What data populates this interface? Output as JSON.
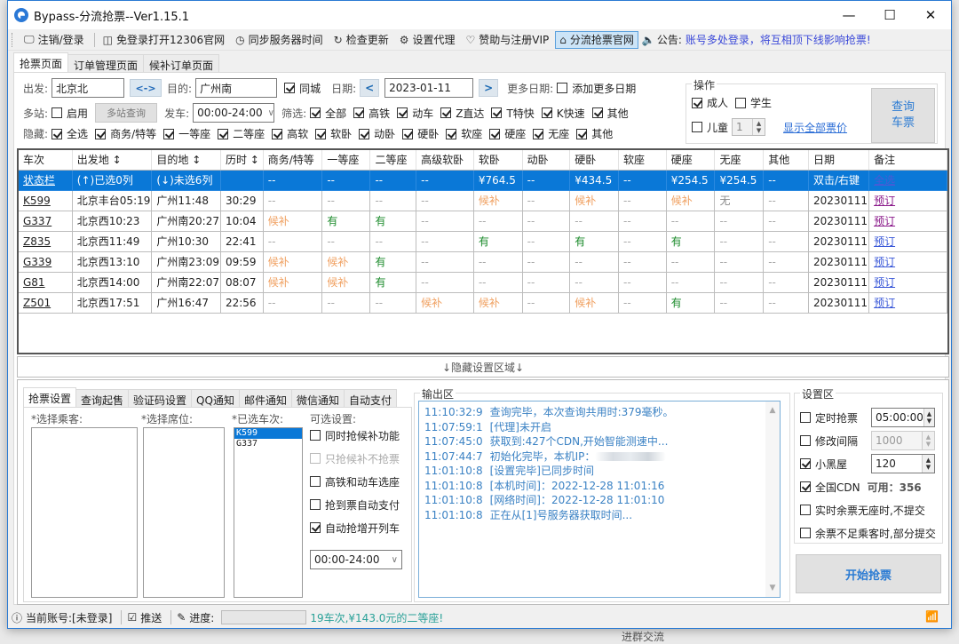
{
  "window": {
    "title": "Bypass-分流抢票--Ver1.15.1",
    "controls": {
      "minimize": "—",
      "maximize": "☐",
      "close": "✕"
    }
  },
  "menubar": {
    "items": [
      {
        "icon": "monitor-icon",
        "glyph": "🖵",
        "label": "注销/登录"
      },
      {
        "icon": "window-icon",
        "glyph": "◫",
        "label": "免登录打开12306官网"
      },
      {
        "icon": "clock-icon",
        "glyph": "◷",
        "label": "同步服务器时间"
      },
      {
        "icon": "refresh-icon",
        "glyph": "↻",
        "label": "检查更新"
      },
      {
        "icon": "gear-icon",
        "glyph": "⚙",
        "label": "设置代理"
      },
      {
        "icon": "heart-icon",
        "glyph": "♡",
        "label": "赞助与注册VIP"
      },
      {
        "icon": "home-icon",
        "glyph": "⌂",
        "label": "分流抢票官网"
      }
    ],
    "notice_label": "公告:",
    "notice_text": "账号多处登录，将互相顶下线影响抢票!"
  },
  "page_tabs": [
    "抢票页面",
    "订单管理页面",
    "候补订单页面"
  ],
  "search": {
    "from_label": "出发:",
    "from_value": "北京北",
    "swap_label": "<->",
    "to_label": "目的:",
    "to_value": "广州南",
    "same_city_label": "同城",
    "same_city_checked": true,
    "date_label": "日期:",
    "date_value": "2023-01-11",
    "prev_label": "<",
    "next_label": ">",
    "more_dates_label": "更多日期:",
    "add_more_dates_label": "添加更多日期",
    "add_more_dates_checked": false,
    "multi_label": "多站:",
    "multi_enable_label": "启用",
    "multi_enable_checked": false,
    "multi_query_label": "多站查询",
    "depart_label": "发车:",
    "depart_value": "00:00-24:00",
    "filter_label": "筛选:",
    "filters": [
      {
        "label": "全部",
        "checked": true
      },
      {
        "label": "高铁",
        "checked": true
      },
      {
        "label": "动车",
        "checked": true
      },
      {
        "label": "Z直达",
        "checked": true
      },
      {
        "label": "T特快",
        "checked": true
      },
      {
        "label": "K快速",
        "checked": true
      },
      {
        "label": "其他",
        "checked": true
      }
    ],
    "hide_label": "隐藏:",
    "hides": [
      {
        "label": "全选",
        "checked": true
      },
      {
        "label": "商务/特等",
        "checked": true
      },
      {
        "label": "一等座",
        "checked": true
      },
      {
        "label": "二等座",
        "checked": true
      },
      {
        "label": "高软",
        "checked": true
      },
      {
        "label": "软卧",
        "checked": true
      },
      {
        "label": "动卧",
        "checked": true
      },
      {
        "label": "硬卧",
        "checked": true
      },
      {
        "label": "软座",
        "checked": true
      },
      {
        "label": "硬座",
        "checked": true
      },
      {
        "label": "无座",
        "checked": true
      },
      {
        "label": "其他",
        "checked": true
      }
    ]
  },
  "operation": {
    "title": "操作",
    "adult_label": "成人",
    "adult_checked": true,
    "student_label": "学生",
    "student_checked": false,
    "child_label": "儿童",
    "child_checked": false,
    "child_count": "1",
    "show_prices_link": "显示全部票价",
    "query_button_line1": "查询",
    "query_button_line2": "车票"
  },
  "grid": {
    "columns": [
      "车次",
      "出发地 ↕",
      "目的地 ↕",
      "历时 ↕",
      "商务/特等",
      "一等座",
      "二等座",
      "高级软卧",
      "软卧",
      "动卧",
      "硬卧",
      "软座",
      "硬座",
      "无座",
      "其他",
      "日期",
      "备注"
    ],
    "status_row": [
      "状态栏",
      "(↑)已选0列",
      "(↓)未选6列",
      "",
      "--",
      "--",
      "--",
      "--",
      "¥764.5",
      "--",
      "¥434.5",
      "--",
      "¥254.5",
      "¥254.5",
      "--",
      "双击/右键",
      "全选"
    ],
    "rows": [
      {
        "train": "K599",
        "from": "北京丰台05:19",
        "to": "广州11:48",
        "duration": "30:29",
        "seats": [
          "--",
          "--",
          "--",
          "--",
          "候补",
          "--",
          "候补",
          "--",
          "候补",
          "无",
          "--"
        ],
        "date": "20230111",
        "note": "预订",
        "note_state": "visited"
      },
      {
        "train": "G337",
        "from": "北京西10:23",
        "to": "广州南20:27",
        "duration": "10:04",
        "seats": [
          "候补",
          "有",
          "有",
          "--",
          "--",
          "--",
          "--",
          "--",
          "--",
          "--",
          "--"
        ],
        "date": "20230111",
        "note": "预订",
        "note_state": "visited"
      },
      {
        "train": "Z835",
        "from": "北京西11:49",
        "to": "广州10:30",
        "duration": "22:41",
        "seats": [
          "--",
          "--",
          "--",
          "--",
          "有",
          "--",
          "有",
          "--",
          "有",
          "--",
          "--"
        ],
        "date": "20230111",
        "note": "预订",
        "note_state": "fresh"
      },
      {
        "train": "G339",
        "from": "北京西13:10",
        "to": "广州南23:09",
        "duration": "09:59",
        "seats": [
          "候补",
          "候补",
          "有",
          "--",
          "--",
          "--",
          "--",
          "--",
          "--",
          "--",
          "--"
        ],
        "date": "20230111",
        "note": "预订",
        "note_state": "fresh"
      },
      {
        "train": "G81",
        "from": "北京西14:00",
        "to": "广州南22:07",
        "duration": "08:07",
        "seats": [
          "候补",
          "候补",
          "有",
          "--",
          "--",
          "--",
          "--",
          "--",
          "--",
          "--",
          "--"
        ],
        "date": "20230111",
        "note": "预订",
        "note_state": "fresh"
      },
      {
        "train": "Z501",
        "from": "北京西17:51",
        "to": "广州16:47",
        "duration": "22:56",
        "seats": [
          "--",
          "--",
          "--",
          "候补",
          "候补",
          "--",
          "候补",
          "--",
          "有",
          "--",
          "--"
        ],
        "date": "20230111",
        "note": "预订",
        "note_state": "fresh"
      }
    ]
  },
  "hide_settings_label": "↓隐藏设置区域↓",
  "settings_tabs": [
    "抢票设置",
    "查询起售",
    "验证码设置",
    "QQ通知",
    "邮件通知",
    "微信通知",
    "自动支付"
  ],
  "ticket_settings": {
    "passenger_label": "*选择乘客:",
    "seat_label": "*选择席位:",
    "selected_trains_label": "*已选车次:",
    "selected_trains": [
      "K599",
      "G337"
    ],
    "optional_label": "可选设置:",
    "options": [
      {
        "label": "同时抢候补功能",
        "checked": false,
        "disabled": false
      },
      {
        "label": "只抢候补不抢票",
        "checked": false,
        "disabled": true
      },
      {
        "label": "高铁和动车选座",
        "checked": false,
        "disabled": false
      },
      {
        "label": "抢到票自动支付",
        "checked": false,
        "disabled": false
      },
      {
        "label": "自动抢增开列车",
        "checked": true,
        "disabled": false
      }
    ],
    "added_train_time": "00:00-24:00"
  },
  "output": {
    "title": "输出区",
    "lines": [
      {
        "ts": "11:10:32:9",
        "msg": "查询完毕，本次查询共用时:379毫秒。"
      },
      {
        "ts": "11:07:59:1",
        "msg": "[代理]未开启"
      },
      {
        "ts": "11:07:45:0",
        "msg": "获取到:427个CDN,开始智能测速中..."
      },
      {
        "ts": "11:07:44:7",
        "msg": "初始化完毕，本机IP：",
        "redacted": true
      },
      {
        "ts": "11:01:10:8",
        "msg": "[设置完毕]已同步时间"
      },
      {
        "ts": "11:01:10:8",
        "msg": "[本机时间]：2022-12-28 11:01:16"
      },
      {
        "ts": "11:01:10:8",
        "msg": "[网络时间]：2022-12-28 11:01:10"
      },
      {
        "ts": "11:01:10:8",
        "msg": "正在从[1]号服务器获取时间..."
      }
    ]
  },
  "settings_area": {
    "title": "设置区",
    "timed_label": "定时抢票",
    "timed_checked": false,
    "timed_value": "05:00:00",
    "interval_label": "修改间隔",
    "interval_checked": false,
    "interval_value": "1000",
    "blackroom_label": "小黑屋",
    "blackroom_checked": true,
    "blackroom_value": "120",
    "cdn_label": "全国CDN",
    "cdn_checked": true,
    "cdn_available": "可用：356",
    "no_seat_label": "实时余票无座时,不提交",
    "no_seat_checked": false,
    "partial_label": "余票不足乘客时,部分提交",
    "partial_checked": false,
    "start_button": "开始抢票"
  },
  "statusbar": {
    "account": "当前账号:[未登录]",
    "push_label": "推送",
    "progress_label": "进度:",
    "progress_value": 0,
    "marquee": "19车次,¥143.0元的二等座!"
  },
  "background_text": "进群交流"
}
